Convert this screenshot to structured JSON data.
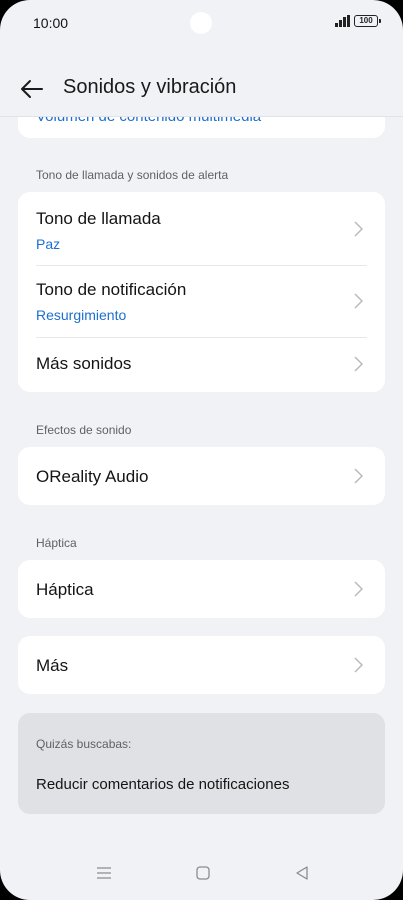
{
  "status": {
    "time": "10:00",
    "battery": "100"
  },
  "header": {
    "title": "Sonidos y vibración"
  },
  "top_card": {
    "text": "Volumen de contenido multimedia"
  },
  "sections": {
    "ringtones": {
      "label": "Tono de llamada y sonidos de alerta",
      "items": [
        {
          "title": "Tono de llamada",
          "value": "Paz"
        },
        {
          "title": "Tono de notificación",
          "value": "Resurgimiento"
        },
        {
          "title": "Más sonidos"
        }
      ]
    },
    "effects": {
      "label": "Efectos de sonido",
      "items": [
        {
          "title": "OReality Audio"
        }
      ]
    },
    "haptics": {
      "label": "Háptica",
      "items": [
        {
          "title": "Háptica"
        }
      ]
    },
    "more": {
      "items": [
        {
          "title": "Más"
        }
      ]
    }
  },
  "suggestion": {
    "label": "Quizás buscabas:",
    "link": "Reducir comentarios de notificaciones"
  },
  "navbar": {
    "icons": [
      "menu-icon",
      "home-icon",
      "back-triangle-icon"
    ]
  }
}
